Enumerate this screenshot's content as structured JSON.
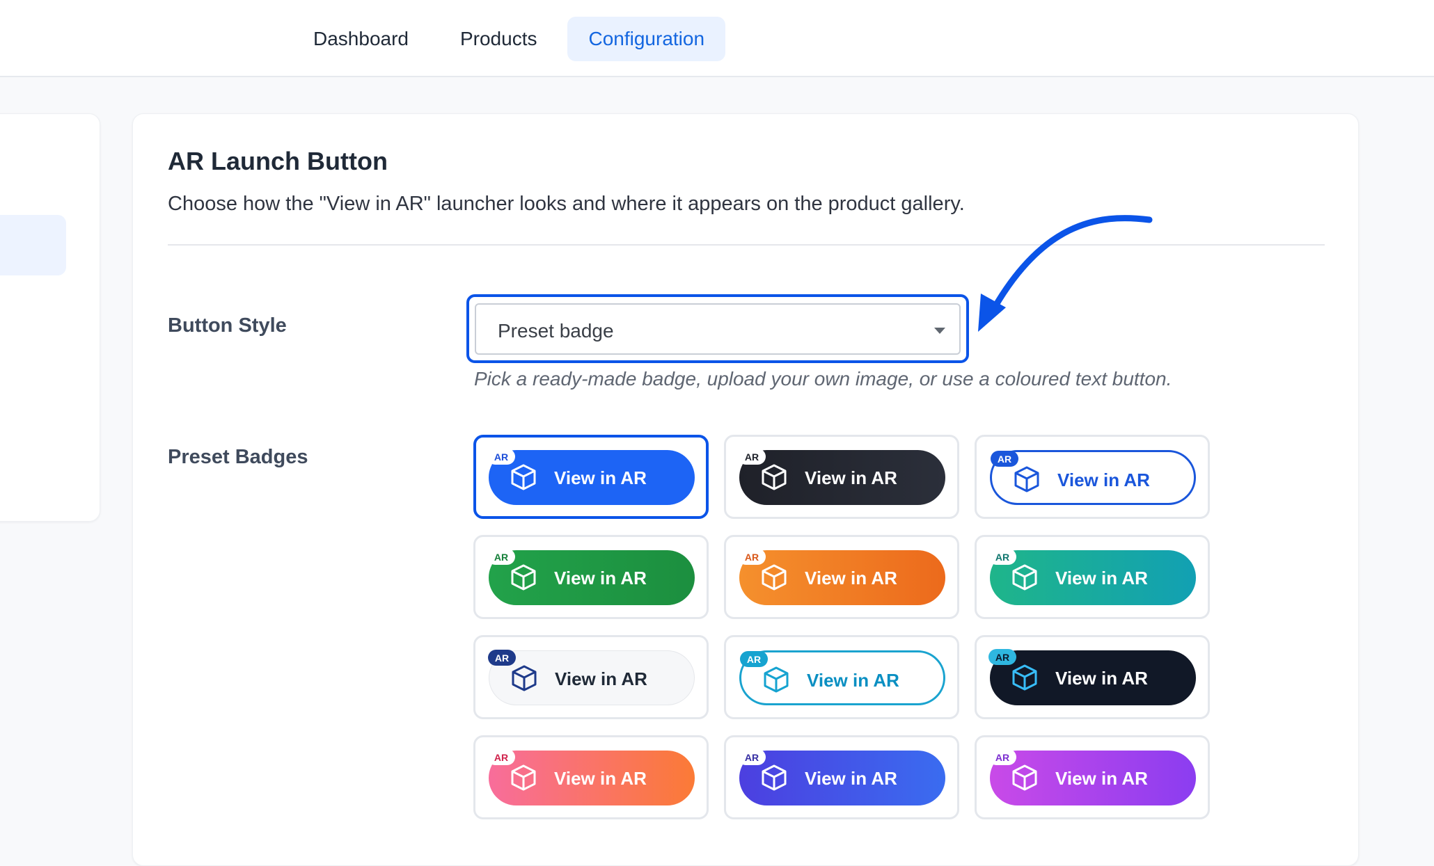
{
  "nav": {
    "tabs": [
      {
        "label": "Dashboard",
        "active": false
      },
      {
        "label": "Products",
        "active": false
      },
      {
        "label": "Configuration",
        "active": true
      }
    ]
  },
  "card": {
    "title": "AR Launch Button",
    "description": "Choose how the \"View in AR\" launcher looks and where it appears on the product gallery."
  },
  "button_style": {
    "label": "Button Style",
    "selected": "Preset badge",
    "help": "Pick a ready-made badge, upload your own image, or use a coloured text button."
  },
  "preset_badges": {
    "label": "Preset Badges",
    "items": [
      {
        "text": "View in AR",
        "tag": "AR",
        "selected": true,
        "style": "blue-solid",
        "bg": "#1d64f5",
        "text_color": "#ffffff",
        "tag_bg": "#ffffff",
        "tag_color": "#1d4ed8"
      },
      {
        "text": "View in AR",
        "tag": "AR",
        "selected": false,
        "style": "dark-solid",
        "bg": "#20232b",
        "text_color": "#ffffff",
        "tag_bg": "#ffffff",
        "tag_color": "#20232b"
      },
      {
        "text": "View in AR",
        "tag": "AR",
        "selected": false,
        "style": "blue-outline",
        "bg": "#ffffff",
        "text_color": "#1a56db",
        "tag_bg": "#1a56db",
        "tag_color": "#ffffff"
      },
      {
        "text": "View in AR",
        "tag": "AR",
        "selected": false,
        "style": "green-solid",
        "bg": "#219a45",
        "text_color": "#ffffff",
        "tag_bg": "#ffffff",
        "tag_color": "#16803a"
      },
      {
        "text": "View in AR",
        "tag": "AR",
        "selected": false,
        "style": "orange-solid",
        "bg": "#f17a26",
        "text_color": "#ffffff",
        "tag_bg": "#ffffff",
        "tag_color": "#d9581a"
      },
      {
        "text": "View in AR",
        "tag": "AR",
        "selected": false,
        "style": "teal-gradient",
        "bg": "#17ab99",
        "text_color": "#ffffff",
        "tag_bg": "#ffffff",
        "tag_color": "#0f766e"
      },
      {
        "text": "View in AR",
        "tag": "AR",
        "selected": false,
        "style": "light-solid",
        "bg": "#f6f7f9",
        "text_color": "#1f2937",
        "tag_bg": "#1e3a8a",
        "tag_color": "#ffffff"
      },
      {
        "text": "View in AR",
        "tag": "AR",
        "selected": false,
        "style": "cyan-outline",
        "bg": "#ffffff",
        "text_color": "#0a8fc2",
        "tag_bg": "#16a3d0",
        "tag_color": "#ffffff"
      },
      {
        "text": "View in AR",
        "tag": "AR",
        "selected": false,
        "style": "navy-solid",
        "bg": "#111827",
        "text_color": "#ffffff",
        "tag_bg": "#2fb7e0",
        "tag_color": "#0b1a2e"
      },
      {
        "text": "View in AR",
        "tag": "AR",
        "selected": false,
        "style": "pink-gradient",
        "bg": "#f8698a",
        "text_color": "#ffffff",
        "tag_bg": "#ffffff",
        "tag_color": "#d0234c"
      },
      {
        "text": "View in AR",
        "tag": "AR",
        "selected": false,
        "style": "indigo-gradient",
        "bg": "#4b4ee6",
        "text_color": "#ffffff",
        "tag_bg": "#ffffff",
        "tag_color": "#3730a3"
      },
      {
        "text": "View in AR",
        "tag": "AR",
        "selected": false,
        "style": "purple-gradient",
        "bg": "#b24ff0",
        "text_color": "#ffffff",
        "tag_bg": "#ffffff",
        "tag_color": "#7c2fd0"
      }
    ]
  },
  "colors": {
    "accent": "#0b54e8",
    "nav_active_bg": "#eaf2ff",
    "nav_active_text": "#1366e0"
  },
  "icons": [
    "cube-icon",
    "chevron-down-icon",
    "curved-arrow-icon"
  ]
}
